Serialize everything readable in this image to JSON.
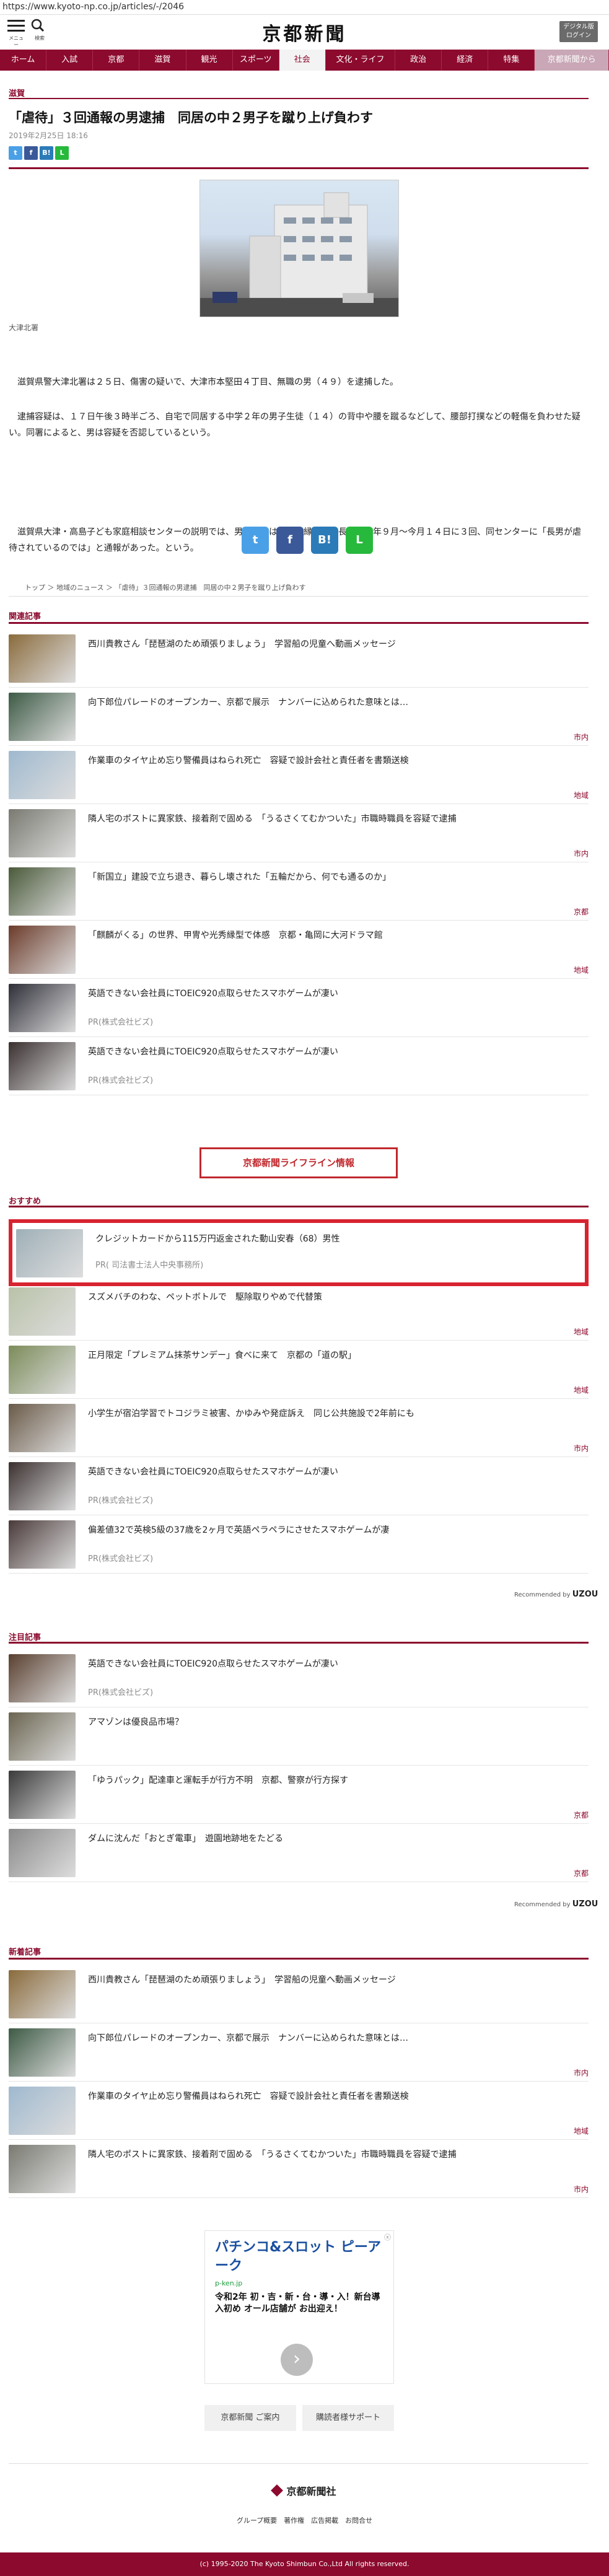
{
  "url": "https://www.kyoto-np.co.jp/articles/-/2046",
  "header": {
    "menu_label": "メニュー",
    "search_label": "検索",
    "logo": "京都新聞",
    "digital_btn": "デジタル版 ログイン"
  },
  "nav": [
    "ホーム",
    "入試",
    "京都",
    "滋賀",
    "観光",
    "スポーツ",
    "社会",
    "文化・ライフ",
    "政治",
    "経済",
    "特集",
    "京都新聞から"
  ],
  "nav_active": "社会",
  "article": {
    "section": "滋賀",
    "title": "「虐待」３回通報の男逮捕　同居の中２男子を蹴り上げ負わす",
    "date": "2019年2月25日 18:16",
    "photo_caption": "大津北署",
    "paragraphs": [
      "滋賀県警大津北署は２５日、傷害の疑いで、大津市本堅田４丁目、無職の男（４９）を逮捕した。",
      "逮捕容疑は、１７日午後３時半ごろ、自宅で同居する中学２年の男子生徒（１４）の背中や腰を蹴るなどして、腰部打撲などの軽傷を負わせた疑い。同署によると、男は容疑を否認しているという。",
      "滋賀県大津・高島子ども家庭相談センターの説明では、男子生徒は男の内縁の妻の長男。昨年９月～今月１４日に３回、同センターに「長男が虐待されているのでは」と通報があった。という。"
    ],
    "breadcrumb": [
      "トップ",
      "地域のニュース",
      "「虐待」３回通報の男逮捕　同居の中２男子を蹴り上げ負わす"
    ]
  },
  "share": {
    "twitter": "t",
    "facebook": "f",
    "hatena": "B!",
    "line": "L"
  },
  "related": {
    "heading": "関連記事",
    "items": [
      {
        "title": "西川貴教さん「琵琶湖のため頑張りましょう」　学習船の児童へ動画メッセージ",
        "tag": "",
        "color": "#8a6b3c"
      },
      {
        "title": "向下郎位パレードのオープンカー、京都で展示　ナンバーに込められた意味とは…",
        "tag": "市内",
        "color": "#3d5a45"
      },
      {
        "title": "作業車のタイヤ止め忘り警備員はねられ死亡　容疑で設計会社と責任者を書類送検",
        "tag": "地域",
        "color": "#9fb9cf"
      },
      {
        "title": "隣人宅のポストに異家鉄、接着剤で固める　「うるさくてむかついた」市職時職員を容疑で逮捕",
        "tag": "市内",
        "color": "#7a7a72"
      },
      {
        "title": "「新国立」建設で立ち退き、暮らし壊された「五輪だから、何でも通るのか」",
        "tag": "京都",
        "color": "#4a5a3a"
      },
      {
        "title": "「麒麟がくる」の世界、甲冑や光秀縁型で体感　京都・亀岡に大河ドラマ館",
        "tag": "地域",
        "color": "#6b3b2a"
      },
      {
        "title": "英語できない会社員にTOEIC920点取らせたスマホゲームが凄い",
        "pr": "PR(株式会社ビズ)",
        "color": "#2e2e38"
      },
      {
        "title": "英語できない会社員にTOEIC920点取らせたスマホゲームが凄い",
        "pr": "PR(株式会社ビズ)",
        "color": "#3a3030"
      }
    ]
  },
  "lifeline": "京都新聞ライフライン情報",
  "recommend": {
    "heading": "おすすめ",
    "items": [
      {
        "title": "クレジットカードから115万円返金された動山安春（68）男性",
        "pr": "PR( 司法書士法人中央事務所)",
        "color": "#9fb0b8"
      },
      {
        "title": "スズメバチのわな、ペットボトルで　駆除取りやめで代替策",
        "tag": "地域",
        "color": "#b9c2a8"
      },
      {
        "title": "正月限定「プレミアム抹茶サンデー」食べに来て　京都の「道の駅」",
        "tag": "地域",
        "color": "#7c8c5a"
      },
      {
        "title": "小学生が宿泊学習でトコジラミ被害、かゆみや発症訴え　同じ公共施設で2年前にも",
        "tag": "市内",
        "color": "#6a5a48"
      },
      {
        "title": "英語できない会社員にTOEIC920点取らせたスマホゲームが凄い",
        "pr": "PR(株式会社ビズ)",
        "color": "#3b3030"
      },
      {
        "title": "偏差値32で英検5級の37歳を2ヶ月で英語ペラペラにさせたスマホゲームが凄",
        "pr": "PR(株式会社ビズ)",
        "color": "#4a3a3a"
      }
    ],
    "credit": "Recommended by",
    "credit_brand": "UZOU"
  },
  "attention": {
    "heading": "注目記事",
    "items": [
      {
        "title": "英語できない会社員にTOEIC920点取らせたスマホゲームが凄い",
        "pr": "PR(株式会社ビズ)",
        "color": "#5a4030"
      },
      {
        "title": "アマゾンは優良品市場？",
        "tag": "",
        "color": "#6a6450"
      },
      {
        "title": "「ゆうパック」配達車と運転手が行方不明　京都、警察が行方探す",
        "tag": "京都",
        "color": "#3a3a3a"
      },
      {
        "title": "ダムに沈んだ「おとぎ電車」　遊園地跡地をたどる",
        "tag": "京都",
        "color": "#8a8a8a"
      }
    ],
    "credit": "Recommended by",
    "credit_brand": "UZOU"
  },
  "latest": {
    "heading": "新着記事",
    "items": [
      {
        "title": "西川貴教さん「琵琶湖のため頑張りましょう」　学習船の児童へ動画メッセージ",
        "tag": "",
        "color": "#8a6b3c"
      },
      {
        "title": "向下郎位パレードのオープンカー、京都で展示　ナンバーに込められた意味とは…",
        "tag": "市内",
        "color": "#3d5a45"
      },
      {
        "title": "作業車のタイヤ止め忘り警備員はねられ死亡　容疑で設計会社と責任者を書類送検",
        "tag": "地域",
        "color": "#9fb9cf"
      },
      {
        "title": "隣人宅のポストに異家鉄、接着剤で固める　「うるさくてむかついた」市職時職員を容疑で逮捕",
        "tag": "市内",
        "color": "#7a7a72"
      }
    ]
  },
  "ad": {
    "title": "パチンコ&スロット ピーアーク",
    "domain": "p-ken.jp",
    "body": "令和2年 初・吉・新・台・導・入！新台導入初め オール店舗が お出迎え！"
  },
  "footer_buttons": [
    "京都新聞 ご案内",
    "購読者様サポート"
  ],
  "footer_logo": "京都新聞社",
  "footer_links": [
    "グループ概要",
    "著作権",
    "広告掲載",
    "お問合せ"
  ],
  "copyright": "(c) 1995-2020 The Kyoto Shimbun Co.,Ltd All rights reserved."
}
